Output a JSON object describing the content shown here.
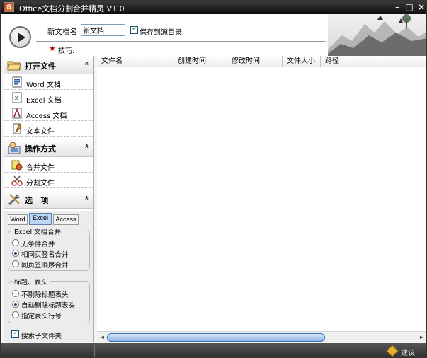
{
  "window": {
    "title": "Office文档分割合并精灵 V1.0",
    "icon_text": "合",
    "minimize": "–",
    "maximize": "□",
    "close": "×"
  },
  "header": {
    "doc_name_label": "新文档名",
    "doc_name_value": "新文档",
    "save_to_source_label": "保存到源目录",
    "save_to_source_checked": true,
    "tip_star": "★",
    "tip_label": "技巧:"
  },
  "sidebar": {
    "open_file": {
      "title": "打开文件",
      "items": [
        {
          "label": "Word 文档"
        },
        {
          "label": "Excel 文档"
        },
        {
          "label": "Access 文档"
        },
        {
          "label": "文本文件"
        }
      ]
    },
    "operation": {
      "title": "操作方式",
      "items": [
        {
          "label": "合并文件"
        },
        {
          "label": "分割文件"
        }
      ]
    },
    "options": {
      "title": "选   项"
    },
    "chevron": "«"
  },
  "options_panel": {
    "tabs": [
      {
        "label": "Word",
        "active": false
      },
      {
        "label": "Excel",
        "active": true
      },
      {
        "label": "Access",
        "active": false
      }
    ],
    "merge_group": {
      "legend": "Excel 文档合并",
      "options": [
        {
          "label": "无条件合并",
          "selected": false
        },
        {
          "label": "相同页签名合并",
          "selected": true
        },
        {
          "label": "同页签顺序合并",
          "selected": false
        }
      ]
    },
    "header_group": {
      "legend": "标题、表头",
      "options": [
        {
          "label": "不剔除标题表头",
          "selected": false
        },
        {
          "label": "自动剔除标题表头",
          "selected": true
        },
        {
          "label": "指定表头行号",
          "selected": false
        }
      ]
    },
    "search_subfolders_label": "搜索子文件夹",
    "search_subfolders_checked": true
  },
  "table": {
    "columns": [
      "文件名",
      "创建时间",
      "修改时间",
      "文件大小",
      "路径"
    ],
    "rows": []
  },
  "scrollbar": {
    "left_arrow": "◄",
    "right_arrow": "►"
  },
  "statusbar": {
    "suggest_label": "建议"
  }
}
